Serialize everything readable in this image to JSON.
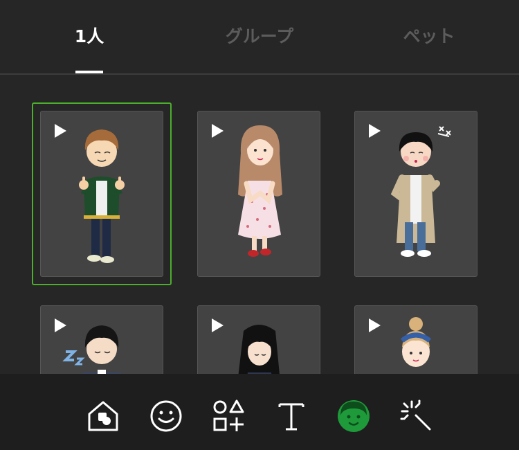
{
  "tabs": [
    {
      "label": "1人",
      "active": true
    },
    {
      "label": "グループ",
      "active": false
    },
    {
      "label": "ペット",
      "active": false
    }
  ],
  "colors": {
    "background": "#262626",
    "toolbar": "#1e1e1e",
    "card": "#434343",
    "selection": "#4caf2c",
    "active_tab": "#ffffff",
    "inactive_tab": "#5c5c5c"
  },
  "avatars": [
    {
      "name": "boy-varsity-jacket-thumbs-up",
      "selected": true,
      "icon": "play-icon"
    },
    {
      "name": "girl-floral-dress-heart-hands",
      "selected": false,
      "icon": "play-icon"
    },
    {
      "name": "boy-trench-coat-pointing",
      "selected": false,
      "icon": "play-icon"
    },
    {
      "name": "boy-suit-sleeping",
      "selected": false,
      "icon": "play-icon"
    },
    {
      "name": "girl-black-hair-bowing",
      "selected": false,
      "icon": "play-icon"
    },
    {
      "name": "girl-headband-bun",
      "selected": false,
      "icon": "play-icon"
    }
  ],
  "toolbar": {
    "items": [
      {
        "icon": "home-sticker-icon"
      },
      {
        "icon": "smiley-icon"
      },
      {
        "icon": "shapes-icon"
      },
      {
        "icon": "text-icon"
      },
      {
        "icon": "avatar-face-icon",
        "active": true
      },
      {
        "icon": "magic-wand-icon"
      }
    ]
  }
}
